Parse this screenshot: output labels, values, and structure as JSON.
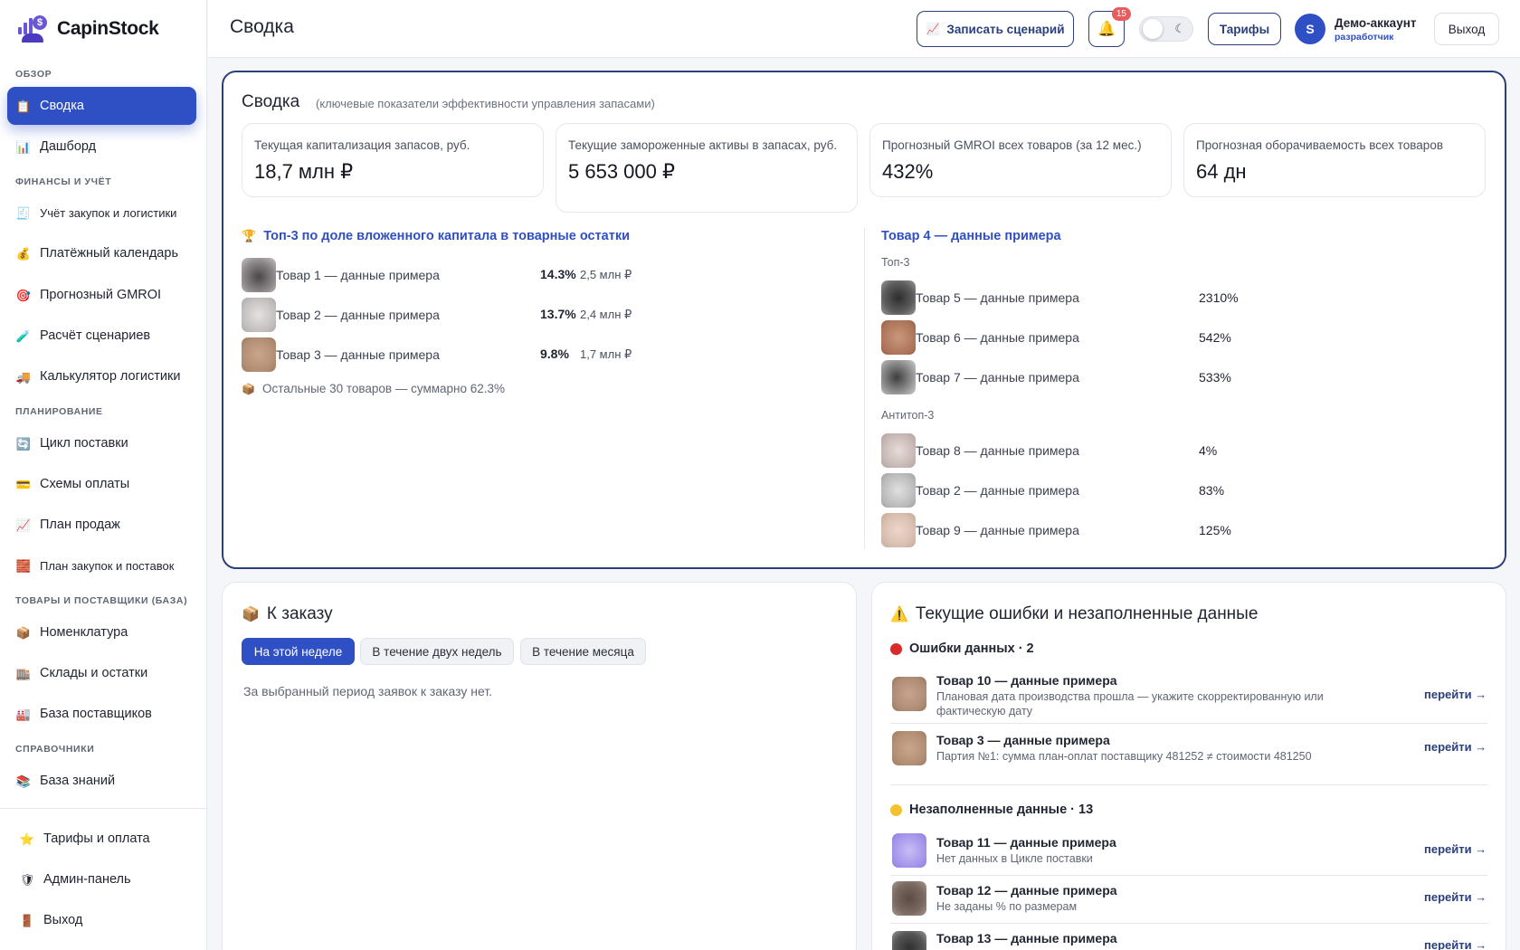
{
  "app": {
    "name": "CapinStock",
    "logo_icon": "capinstock-logo",
    "accent": "#2f4fc4",
    "border_dark": "#2a3f7d"
  },
  "sidebar": {
    "sections": {
      "overview": "ОБЗОР",
      "finance": "ФИНАНСЫ И УЧЁТ",
      "planning": "ПЛАНИРОВАНИЕ",
      "goods": "ТОВАРЫ И ПОСТАВЩИКИ (БАЗА)",
      "refs": "СПРАВОЧНИКИ"
    },
    "items": [
      {
        "label": "Сводка",
        "icon": "📋"
      },
      {
        "label": "Дашборд",
        "icon": "📊"
      },
      {
        "label": "Учёт закупок и логистики",
        "icon": "🧾"
      },
      {
        "label": "Платёжный календарь",
        "icon": "💰"
      },
      {
        "label": "Прогнозный GMROI",
        "icon": "🎯"
      },
      {
        "label": "Расчёт сценариев",
        "icon": "🧪"
      },
      {
        "label": "Калькулятор логистики",
        "icon": "🚚"
      },
      {
        "label": "Цикл поставки",
        "icon": "🔄"
      },
      {
        "label": "Схемы оплаты",
        "icon": "💳"
      },
      {
        "label": "План продаж",
        "icon": "📈"
      },
      {
        "label": "План закупок и поставок",
        "icon": "🧱"
      },
      {
        "label": "Номенклатура",
        "icon": "📦"
      },
      {
        "label": "Склады и остатки",
        "icon": "🏬"
      },
      {
        "label": "База поставщиков",
        "icon": "🏭"
      },
      {
        "label": "База знаний",
        "icon": "📚"
      }
    ],
    "footer": [
      {
        "label": "Тарифы и оплата",
        "icon": "⭐"
      },
      {
        "label": "Админ-панель",
        "icon": "🛡"
      },
      {
        "label": "Выход",
        "icon": "🚪"
      }
    ]
  },
  "header": {
    "title": "Сводка",
    "record_button": "Записать сценарий",
    "record_icon": "📈",
    "notifications_count": "15",
    "bell_icon": "🔔",
    "moon_icon": "☾",
    "tariffs_button": "Тарифы",
    "avatar_letter": "S",
    "account_name": "Демо-аккаунт",
    "account_role": "разработчик",
    "logout_button": "Выход"
  },
  "summary": {
    "title": "Сводка",
    "subtitle": "(ключевые показатели эффективности управления запасами)",
    "kpis": [
      {
        "label": "Текущая капитализация запасов, руб.",
        "value": "18,7 млн ₽"
      },
      {
        "label": "Текущие замороженные активы в запасах, руб.",
        "value": "5 653 000 ₽"
      },
      {
        "label": "Прогнозный GMROI всех товаров (за 12 мес.)",
        "value": "432%"
      },
      {
        "label": "Прогнозная оборачиваемость всех товаров",
        "value": "64 дн"
      }
    ],
    "top_capital": {
      "title": "Топ-3 по доле вложенного капитала в товарные остатки",
      "icon": "🏆",
      "rows": [
        {
          "name": "Товар 1 — данные примера",
          "pct": "14.3%",
          "sum": "2,5 млн ₽",
          "thumb": "#6d6a6c"
        },
        {
          "name": "Товар 2 — данные примера",
          "pct": "13.7%",
          "sum": "2,4 млн ₽",
          "thumb": "#c9c6c4"
        },
        {
          "name": "Товар 3 — данные примера",
          "pct": "9.8%",
          "sum": "1,7 млн ₽",
          "thumb": "#b89376"
        }
      ],
      "rest_icon": "📦",
      "rest": "Остальные 30 товаров — суммарно 62.3%"
    },
    "gmroi": {
      "title": "Товар 4 — данные примера",
      "top_label": "Топ-3",
      "top": [
        {
          "name": "Товар 5 — данные примера",
          "value": "2310%",
          "thumb": "#4b4b4b"
        },
        {
          "name": "Товар 6 — данные примера",
          "value": "542%",
          "thumb": "#b57d62"
        },
        {
          "name": "Товар 7 — данные примера",
          "value": "533%",
          "thumb": "#6a6a6a"
        }
      ],
      "anti_label": "Антитоп-3",
      "anti": [
        {
          "name": "Товар 8 — данные примера",
          "value": "4%",
          "thumb": "#cdbfbc"
        },
        {
          "name": "Товар 2 — данные примера",
          "value": "83%",
          "thumb": "#c2c2c2"
        },
        {
          "name": "Товар 9 — данные примера",
          "value": "125%",
          "thumb": "#dcc4b6"
        }
      ]
    }
  },
  "orders": {
    "title": "К заказу",
    "icon": "📦",
    "tabs": [
      "На этой неделе",
      "В течение двух недель",
      "В течение месяца"
    ],
    "active_tab": "На этой неделе",
    "empty": "За выбранный период заявок к заказу нет."
  },
  "errors": {
    "title": "Текущие ошибки и незаполненные данные",
    "icon": "⚠️",
    "link_label": "перейти →",
    "group_errors": {
      "title": "Ошибки данных · 2",
      "color": "#d92b2b"
    },
    "error_items": [
      {
        "name": "Товар 10 — данные примера",
        "desc": "Плановая дата производства прошла — укажите скорректированную или фактическую дату",
        "thumb": "#b08d76"
      },
      {
        "name": "Товар 3 — данные примера",
        "desc": "Партия №1: сумма план-оплат поставщику 481252 ≠ стоимости 481250",
        "thumb": "#b89376"
      }
    ],
    "group_empty": {
      "title": "Незаполненные данные · 13",
      "color": "#f2c230"
    },
    "empty_items": [
      {
        "name": "Товар 11 — данные примера",
        "desc": "Нет данных в Цикле поставки",
        "thumb": "#a999e8"
      },
      {
        "name": "Товар 12 — данные примера",
        "desc": "Не заданы % по размерам",
        "thumb": "#6e5f58"
      },
      {
        "name": "Товар 13 — данные примера",
        "desc": "",
        "thumb": "#444444"
      }
    ]
  }
}
